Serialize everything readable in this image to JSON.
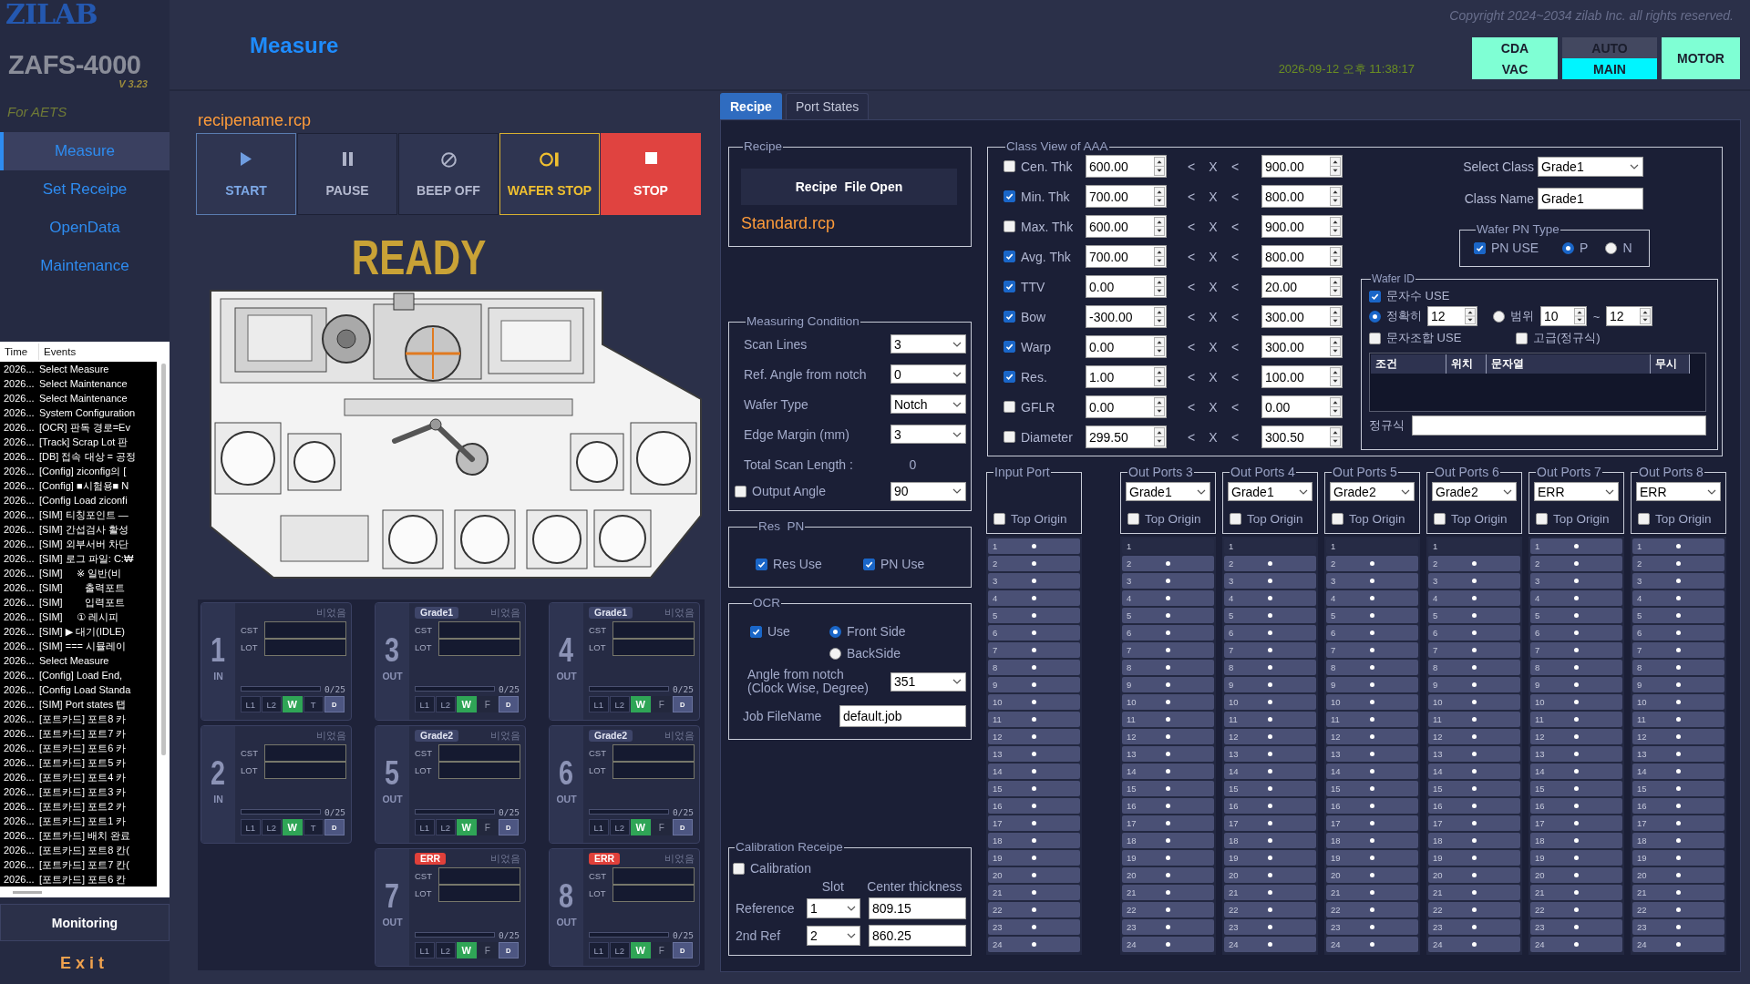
{
  "sidebar": {
    "logo": "ZILAB",
    "product": "ZAFS-4000",
    "version": "V 3.23",
    "customer": "For AETS",
    "nav": [
      {
        "label": "Measure",
        "selected": true
      },
      {
        "label": "Set Receipe",
        "selected": false
      },
      {
        "label": "OpenData",
        "selected": false
      },
      {
        "label": "Maintenance",
        "selected": false
      }
    ],
    "events": {
      "columns": [
        "Time",
        "Events"
      ],
      "rows": [
        {
          "time": "2026...",
          "event": "Select Measure"
        },
        {
          "time": "2026...",
          "event": "Select Maintenance"
        },
        {
          "time": "2026...",
          "event": "Select Maintenance"
        },
        {
          "time": "2026...",
          "event": "System Configuration"
        },
        {
          "time": "2026...",
          "event": "[OCR] 판독 경로=Ev"
        },
        {
          "time": "2026...",
          "event": "[Track] Scrap Lot 판"
        },
        {
          "time": "2026...",
          "event": "[DB] 접속 대상 = 공정"
        },
        {
          "time": "2026...",
          "event": "[Config] ziconfig의 ["
        },
        {
          "time": "2026...",
          "event": "[Config] ■시험용■ N"
        },
        {
          "time": "2026...",
          "event": "[Config Load ziconfi"
        },
        {
          "time": "2026...",
          "event": "[SIM] 티칭포인트 —"
        },
        {
          "time": "2026...",
          "event": "[SIM] 간섭검사 활성"
        },
        {
          "time": "2026...",
          "event": "[SIM] 외부서버 차단"
        },
        {
          "time": "2026...",
          "event": "[SIM] 로그 파일: C:₩"
        },
        {
          "time": "2026...",
          "event": "[SIM]     ※ 일반(비"
        },
        {
          "time": "2026...",
          "event": "[SIM]        출력포트"
        },
        {
          "time": "2026...",
          "event": "[SIM]        입력포트"
        },
        {
          "time": "2026...",
          "event": "[SIM]     ① 레시피"
        },
        {
          "time": "2026...",
          "event": "[SIM] ▶ 대기(IDLE)"
        },
        {
          "time": "2026...",
          "event": "[SIM] === 시뮬레이"
        },
        {
          "time": "2026...",
          "event": "Select Measure"
        },
        {
          "time": "2026...",
          "event": "[Config] Load End,"
        },
        {
          "time": "2026...",
          "event": "[Config Load Standa"
        },
        {
          "time": "2026...",
          "event": "[SIM] Port states 탭"
        },
        {
          "time": "2026...",
          "event": "[포트카드] 포트8 카"
        },
        {
          "time": "2026...",
          "event": "[포트카드] 포트7 카"
        },
        {
          "time": "2026...",
          "event": "[포트카드] 포트6 카"
        },
        {
          "time": "2026...",
          "event": "[포트카드] 포트5 카"
        },
        {
          "time": "2026...",
          "event": "[포트카드] 포트4 카"
        },
        {
          "time": "2026...",
          "event": "[포트카드] 포트3 카"
        },
        {
          "time": "2026...",
          "event": "[포트카드] 포트2 카"
        },
        {
          "time": "2026...",
          "event": "[포트카드] 포트1 카"
        },
        {
          "time": "2026...",
          "event": "[포트카드] 배치 완료"
        },
        {
          "time": "2026...",
          "event": "[포트카드] 포트8 칸("
        },
        {
          "time": "2026...",
          "event": "[포트카드] 포트7 칸("
        },
        {
          "time": "2026...",
          "event": "[포트카드] 포트6 칸"
        }
      ]
    },
    "monitoring_button": "Monitoring",
    "exit_button": "Exit"
  },
  "header": {
    "title": "Measure",
    "copyright": "Copyright 2024~2034 zilab Inc. all rights reserved.",
    "datetime": "2026-09-12 오후 11:38:17",
    "indicators": [
      {
        "cells": [
          {
            "label": "CDA",
            "on": true,
            "color": "#7fffd4"
          },
          {
            "label": "VAC",
            "on": true,
            "color": "#7fffd4"
          }
        ]
      },
      {
        "cells": [
          {
            "label": "AUTO",
            "on": false
          },
          {
            "label": "MAIN",
            "on": true,
            "color": "#00f5ff"
          }
        ]
      },
      {
        "cells": [
          {
            "label": "MOTOR",
            "on": true,
            "color": "#7fffd4"
          }
        ]
      }
    ]
  },
  "controls": {
    "recipe_name": "recipename.rcp",
    "buttons": [
      {
        "kind": "start",
        "label": "START"
      },
      {
        "kind": "pause",
        "label": "PAUSE"
      },
      {
        "kind": "beep",
        "label": "BEEP OFF"
      },
      {
        "kind": "wafer_stop",
        "label": "WAFER STOP"
      },
      {
        "kind": "stop",
        "label": "STOP"
      }
    ],
    "status": "READY"
  },
  "ports": [
    {
      "kind": "in",
      "number": "1",
      "direction": "IN",
      "status": "비었음",
      "cst_label": "CST",
      "lot_label": "LOT",
      "level": 0,
      "count": "0/25",
      "buttons": [
        {
          "kind": "lamp",
          "label": "L1",
          "on": false,
          "disabled": false
        },
        {
          "kind": "lamp",
          "label": "L2",
          "on": false,
          "disabled": false
        },
        {
          "kind": "lamp",
          "label": "W",
          "on": true,
          "disabled": false
        },
        {
          "kind": "lamp",
          "label": "T",
          "on": false,
          "disabled": false
        },
        {
          "kind": "action",
          "label": "D",
          "on": false,
          "disabled": false
        }
      ]
    },
    {
      "kind": "out",
      "number": "3",
      "direction": "OUT",
      "badge": {
        "kind": "grade",
        "text": "Grade1"
      },
      "status": "비었음",
      "cst_label": "CST",
      "lot_label": "LOT",
      "level": 0,
      "count": "0/25",
      "buttons": [
        {
          "kind": "lamp",
          "label": "L1",
          "on": false,
          "disabled": false
        },
        {
          "kind": "lamp",
          "label": "L2",
          "on": false,
          "disabled": false
        },
        {
          "kind": "lamp",
          "label": "W",
          "on": true,
          "disabled": false
        },
        {
          "kind": "lamp",
          "label": "F",
          "on": false,
          "disabled": true
        },
        {
          "kind": "action",
          "label": "D",
          "on": false,
          "disabled": false
        }
      ]
    },
    {
      "kind": "out",
      "number": "4",
      "direction": "OUT",
      "badge": {
        "kind": "grade",
        "text": "Grade1"
      },
      "status": "비었음",
      "cst_label": "CST",
      "lot_label": "LOT",
      "level": 0,
      "count": "0/25",
      "buttons": [
        {
          "kind": "lamp",
          "label": "L1",
          "on": false,
          "disabled": false
        },
        {
          "kind": "lamp",
          "label": "L2",
          "on": false,
          "disabled": false
        },
        {
          "kind": "lamp",
          "label": "W",
          "on": true,
          "disabled": false
        },
        {
          "kind": "lamp",
          "label": "F",
          "on": false,
          "disabled": true
        },
        {
          "kind": "action",
          "label": "D",
          "on": false,
          "disabled": false
        }
      ]
    },
    {
      "kind": "in",
      "number": "2",
      "direction": "IN",
      "status": "비었음",
      "cst_label": "CST",
      "lot_label": "LOT",
      "level": 0,
      "count": "0/25",
      "buttons": [
        {
          "kind": "lamp",
          "label": "L1",
          "on": false,
          "disabled": false
        },
        {
          "kind": "lamp",
          "label": "L2",
          "on": false,
          "disabled": false
        },
        {
          "kind": "lamp",
          "label": "W",
          "on": true,
          "disabled": false
        },
        {
          "kind": "lamp",
          "label": "T",
          "on": false,
          "disabled": false
        },
        {
          "kind": "action",
          "label": "D",
          "on": false,
          "disabled": false
        }
      ]
    },
    {
      "kind": "out",
      "number": "5",
      "direction": "OUT",
      "badge": {
        "kind": "grade",
        "text": "Grade2"
      },
      "status": "비었음",
      "cst_label": "CST",
      "lot_label": "LOT",
      "level": 0,
      "count": "0/25",
      "buttons": [
        {
          "kind": "lamp",
          "label": "L1",
          "on": false,
          "disabled": false
        },
        {
          "kind": "lamp",
          "label": "L2",
          "on": false,
          "disabled": false
        },
        {
          "kind": "lamp",
          "label": "W",
          "on": true,
          "disabled": false
        },
        {
          "kind": "lamp",
          "label": "F",
          "on": false,
          "disabled": true
        },
        {
          "kind": "action",
          "label": "D",
          "on": false,
          "disabled": false
        }
      ]
    },
    {
      "kind": "out",
      "number": "6",
      "direction": "OUT",
      "badge": {
        "kind": "grade",
        "text": "Grade2"
      },
      "status": "비었음",
      "cst_label": "CST",
      "lot_label": "LOT",
      "level": 0,
      "count": "0/25",
      "buttons": [
        {
          "kind": "lamp",
          "label": "L1",
          "on": false,
          "disabled": false
        },
        {
          "kind": "lamp",
          "label": "L2",
          "on": false,
          "disabled": false
        },
        {
          "kind": "lamp",
          "label": "W",
          "on": true,
          "disabled": false
        },
        {
          "kind": "lamp",
          "label": "F",
          "on": false,
          "disabled": true
        },
        {
          "kind": "action",
          "label": "D",
          "on": false,
          "disabled": false
        }
      ]
    },
    {
      "kind": "out",
      "number": "7",
      "direction": "OUT",
      "badge": {
        "kind": "error",
        "text": "ERR"
      },
      "status": "비었음",
      "cst_label": "CST",
      "lot_label": "LOT",
      "level": 0,
      "count": "0/25",
      "buttons": [
        {
          "kind": "lamp",
          "label": "L1",
          "on": false,
          "disabled": false
        },
        {
          "kind": "lamp",
          "label": "L2",
          "on": false,
          "disabled": false
        },
        {
          "kind": "lamp",
          "label": "W",
          "on": true,
          "disabled": false
        },
        {
          "kind": "lamp",
          "label": "F",
          "on": false,
          "disabled": true
        },
        {
          "kind": "action",
          "label": "D",
          "on": false,
          "disabled": false
        }
      ]
    },
    {
      "kind": "out",
      "number": "8",
      "direction": "OUT",
      "badge": {
        "kind": "error",
        "text": "ERR"
      },
      "status": "비었음",
      "cst_label": "CST",
      "lot_label": "LOT",
      "level": 0,
      "count": "0/25",
      "buttons": [
        {
          "kind": "lamp",
          "label": "L1",
          "on": false,
          "disabled": false
        },
        {
          "kind": "lamp",
          "label": "L2",
          "on": false,
          "disabled": false
        },
        {
          "kind": "lamp",
          "label": "W",
          "on": true,
          "disabled": false
        },
        {
          "kind": "lamp",
          "label": "F",
          "on": false,
          "disabled": true
        },
        {
          "kind": "action",
          "label": "D",
          "on": false,
          "disabled": false
        }
      ]
    }
  ],
  "panel": {
    "tabs": [
      {
        "label": "Recipe",
        "selected": true
      },
      {
        "label": "Port States",
        "selected": false
      }
    ],
    "recipe": {
      "title": "Recipe",
      "open_button": "Recipe  File Open",
      "file": "Standard.rcp"
    },
    "measuring": {
      "title": "Measuring Condition",
      "rows": [
        {
          "kind": "select",
          "label": "Scan Lines",
          "value": "3"
        },
        {
          "kind": "select",
          "label": "Ref. Angle from notch",
          "value": "0"
        },
        {
          "kind": "select",
          "label": "Wafer Type",
          "value": "Notch"
        },
        {
          "kind": "select",
          "label": "Edge Margin (mm)",
          "value": "3"
        },
        {
          "kind": "readout",
          "label": "Total Scan Length :",
          "value": "0"
        },
        {
          "kind": "check_select",
          "label": "Output Angle",
          "checked": false,
          "value": "90"
        }
      ]
    },
    "res_pn": {
      "title": "Res  PN",
      "items": [
        {
          "label": "Res Use",
          "checked": true
        },
        {
          "label": "PN Use",
          "checked": true
        }
      ]
    },
    "ocr": {
      "title": "OCR",
      "use": {
        "label": "Use",
        "checked": true
      },
      "sides": [
        {
          "label": "Front Side",
          "selected": true
        },
        {
          "label": "BackSide",
          "selected": false
        }
      ],
      "angle_label": [
        "Angle from notch",
        "(Clock Wise, Degree)"
      ],
      "angle": "351",
      "job_label": "Job FileName",
      "job_file": "default.job"
    },
    "calibration": {
      "title": "Calibration Receipe",
      "enable": {
        "label": "Calibration",
        "checked": false
      },
      "slot_header": "Slot",
      "thickness_header": "Center thickness",
      "rows": [
        {
          "label": "Reference",
          "slot": "1",
          "thickness": "809.15"
        },
        {
          "label": "2nd Ref",
          "slot": "2",
          "thickness": "860.25"
        }
      ]
    },
    "class_view": {
      "title": "Class View of AAA",
      "rows": [
        {
          "label": "Cen. Thk",
          "checked": false,
          "min": "600.00",
          "op1": "<",
          "var": "X",
          "op2": "<",
          "max": "900.00"
        },
        {
          "label": "Min. Thk",
          "checked": true,
          "min": "700.00",
          "op1": "<",
          "var": "X",
          "op2": "<",
          "max": "800.00"
        },
        {
          "label": "Max. Thk",
          "checked": false,
          "min": "600.00",
          "op1": "<",
          "var": "X",
          "op2": "<",
          "max": "900.00"
        },
        {
          "label": "Avg. Thk",
          "checked": true,
          "min": "700.00",
          "op1": "<",
          "var": "X",
          "op2": "<",
          "max": "800.00"
        },
        {
          "label": "TTV",
          "checked": true,
          "min": "0.00",
          "op1": "<",
          "var": "X",
          "op2": "<",
          "max": "20.00"
        },
        {
          "label": "Bow",
          "checked": true,
          "min": "-300.00",
          "op1": "<",
          "var": "X",
          "op2": "<",
          "max": "300.00"
        },
        {
          "label": "Warp",
          "checked": true,
          "min": "0.00",
          "op1": "<",
          "var": "X",
          "op2": "<",
          "max": "300.00"
        },
        {
          "label": "Res.",
          "checked": true,
          "min": "1.00",
          "op1": "<",
          "var": "X",
          "op2": "<",
          "max": "100.00"
        },
        {
          "label": "GFLR",
          "checked": false,
          "min": "0.00",
          "op1": "<",
          "var": "X",
          "op2": "<",
          "max": "0.00"
        },
        {
          "label": "Diameter",
          "checked": false,
          "min": "299.50",
          "op1": "<",
          "var": "X",
          "op2": "<",
          "max": "300.50"
        }
      ],
      "select_class_label": "Select Class",
      "select_class": "Grade1",
      "class_name_label": "Class Name",
      "class_name": "Grade1",
      "pn_type": {
        "title": "Wafer PN Type",
        "use": {
          "label": "PN USE",
          "checked": true
        },
        "types": [
          {
            "label": "P",
            "selected": true
          },
          {
            "label": "N",
            "selected": false
          }
        ]
      },
      "wafer_id": {
        "title": "Wafer ID",
        "count_use": {
          "label": "문자수 USE",
          "checked": true
        },
        "exact": {
          "label": "정확히",
          "selected": true,
          "value": "12"
        },
        "range": {
          "label": "범위",
          "selected": false,
          "from": "10",
          "separator": "~",
          "to": "12"
        },
        "combo_use": {
          "label": "문자조합 USE",
          "checked": false
        },
        "regex_use": {
          "label": "고급(정규식)",
          "checked": false
        },
        "table_columns": [
          "조건",
          "위치",
          "문자열",
          "무시"
        ],
        "regex_label": "정규식"
      }
    },
    "port_groups": [
      {
        "title": "Input Port",
        "top_origin": {
          "label": "Top Origin",
          "checked": false
        },
        "slots": [
          {
            "number": "1",
            "disabled": false
          },
          {
            "number": "2",
            "disabled": false
          },
          {
            "number": "3",
            "disabled": false
          },
          {
            "number": "4",
            "disabled": false
          },
          {
            "number": "5",
            "disabled": false
          },
          {
            "number": "6",
            "disabled": false
          },
          {
            "number": "7",
            "disabled": false
          },
          {
            "number": "8",
            "disabled": false
          },
          {
            "number": "9",
            "disabled": false
          },
          {
            "number": "10",
            "disabled": false
          },
          {
            "number": "11",
            "disabled": false
          },
          {
            "number": "12",
            "disabled": false
          },
          {
            "number": "13",
            "disabled": false
          },
          {
            "number": "14",
            "disabled": false
          },
          {
            "number": "15",
            "disabled": false
          },
          {
            "number": "16",
            "disabled": false
          },
          {
            "number": "17",
            "disabled": false
          },
          {
            "number": "18",
            "disabled": false
          },
          {
            "number": "19",
            "disabled": false
          },
          {
            "number": "20",
            "disabled": false
          },
          {
            "number": "21",
            "disabled": false
          },
          {
            "number": "22",
            "disabled": false
          },
          {
            "number": "23",
            "disabled": false
          },
          {
            "number": "24",
            "disabled": false
          }
        ]
      },
      {
        "title": "Out Ports 3",
        "grade": "Grade1",
        "top_origin": {
          "label": "Top Origin",
          "checked": false
        },
        "slots": [
          {
            "number": "1",
            "disabled": true
          },
          {
            "number": "2",
            "disabled": false
          },
          {
            "number": "3",
            "disabled": false
          },
          {
            "number": "4",
            "disabled": false
          },
          {
            "number": "5",
            "disabled": false
          },
          {
            "number": "6",
            "disabled": false
          },
          {
            "number": "7",
            "disabled": false
          },
          {
            "number": "8",
            "disabled": false
          },
          {
            "number": "9",
            "disabled": false
          },
          {
            "number": "10",
            "disabled": false
          },
          {
            "number": "11",
            "disabled": false
          },
          {
            "number": "12",
            "disabled": false
          },
          {
            "number": "13",
            "disabled": false
          },
          {
            "number": "14",
            "disabled": false
          },
          {
            "number": "15",
            "disabled": false
          },
          {
            "number": "16",
            "disabled": false
          },
          {
            "number": "17",
            "disabled": false
          },
          {
            "number": "18",
            "disabled": false
          },
          {
            "number": "19",
            "disabled": false
          },
          {
            "number": "20",
            "disabled": false
          },
          {
            "number": "21",
            "disabled": false
          },
          {
            "number": "22",
            "disabled": false
          },
          {
            "number": "23",
            "disabled": false
          },
          {
            "number": "24",
            "disabled": false
          }
        ]
      },
      {
        "title": "Out Ports 4",
        "grade": "Grade1",
        "top_origin": {
          "label": "Top Origin",
          "checked": false
        },
        "slots": [
          {
            "number": "1",
            "disabled": true
          },
          {
            "number": "2",
            "disabled": false
          },
          {
            "number": "3",
            "disabled": false
          },
          {
            "number": "4",
            "disabled": false
          },
          {
            "number": "5",
            "disabled": false
          },
          {
            "number": "6",
            "disabled": false
          },
          {
            "number": "7",
            "disabled": false
          },
          {
            "number": "8",
            "disabled": false
          },
          {
            "number": "9",
            "disabled": false
          },
          {
            "number": "10",
            "disabled": false
          },
          {
            "number": "11",
            "disabled": false
          },
          {
            "number": "12",
            "disabled": false
          },
          {
            "number": "13",
            "disabled": false
          },
          {
            "number": "14",
            "disabled": false
          },
          {
            "number": "15",
            "disabled": false
          },
          {
            "number": "16",
            "disabled": false
          },
          {
            "number": "17",
            "disabled": false
          },
          {
            "number": "18",
            "disabled": false
          },
          {
            "number": "19",
            "disabled": false
          },
          {
            "number": "20",
            "disabled": false
          },
          {
            "number": "21",
            "disabled": false
          },
          {
            "number": "22",
            "disabled": false
          },
          {
            "number": "23",
            "disabled": false
          },
          {
            "number": "24",
            "disabled": false
          }
        ]
      },
      {
        "title": "Out Ports 5",
        "grade": "Grade2",
        "top_origin": {
          "label": "Top Origin",
          "checked": false
        },
        "slots": [
          {
            "number": "1",
            "disabled": true
          },
          {
            "number": "2",
            "disabled": false
          },
          {
            "number": "3",
            "disabled": false
          },
          {
            "number": "4",
            "disabled": false
          },
          {
            "number": "5",
            "disabled": false
          },
          {
            "number": "6",
            "disabled": false
          },
          {
            "number": "7",
            "disabled": false
          },
          {
            "number": "8",
            "disabled": false
          },
          {
            "number": "9",
            "disabled": false
          },
          {
            "number": "10",
            "disabled": false
          },
          {
            "number": "11",
            "disabled": false
          },
          {
            "number": "12",
            "disabled": false
          },
          {
            "number": "13",
            "disabled": false
          },
          {
            "number": "14",
            "disabled": false
          },
          {
            "number": "15",
            "disabled": false
          },
          {
            "number": "16",
            "disabled": false
          },
          {
            "number": "17",
            "disabled": false
          },
          {
            "number": "18",
            "disabled": false
          },
          {
            "number": "19",
            "disabled": false
          },
          {
            "number": "20",
            "disabled": false
          },
          {
            "number": "21",
            "disabled": false
          },
          {
            "number": "22",
            "disabled": false
          },
          {
            "number": "23",
            "disabled": false
          },
          {
            "number": "24",
            "disabled": false
          }
        ]
      },
      {
        "title": "Out Ports 6",
        "grade": "Grade2",
        "top_origin": {
          "label": "Top Origin",
          "checked": false
        },
        "slots": [
          {
            "number": "1",
            "disabled": true
          },
          {
            "number": "2",
            "disabled": false
          },
          {
            "number": "3",
            "disabled": false
          },
          {
            "number": "4",
            "disabled": false
          },
          {
            "number": "5",
            "disabled": false
          },
          {
            "number": "6",
            "disabled": false
          },
          {
            "number": "7",
            "disabled": false
          },
          {
            "number": "8",
            "disabled": false
          },
          {
            "number": "9",
            "disabled": false
          },
          {
            "number": "10",
            "disabled": false
          },
          {
            "number": "11",
            "disabled": false
          },
          {
            "number": "12",
            "disabled": false
          },
          {
            "number": "13",
            "disabled": false
          },
          {
            "number": "14",
            "disabled": false
          },
          {
            "number": "15",
            "disabled": false
          },
          {
            "number": "16",
            "disabled": false
          },
          {
            "number": "17",
            "disabled": false
          },
          {
            "number": "18",
            "disabled": false
          },
          {
            "number": "19",
            "disabled": false
          },
          {
            "number": "20",
            "disabled": false
          },
          {
            "number": "21",
            "disabled": false
          },
          {
            "number": "22",
            "disabled": false
          },
          {
            "number": "23",
            "disabled": false
          },
          {
            "number": "24",
            "disabled": false
          }
        ]
      },
      {
        "title": "Out Ports 7",
        "grade": "ERR",
        "top_origin": {
          "label": "Top Origin",
          "checked": false
        },
        "slots": [
          {
            "number": "1",
            "disabled": false
          },
          {
            "number": "2",
            "disabled": false
          },
          {
            "number": "3",
            "disabled": false
          },
          {
            "number": "4",
            "disabled": false
          },
          {
            "number": "5",
            "disabled": false
          },
          {
            "number": "6",
            "disabled": false
          },
          {
            "number": "7",
            "disabled": false
          },
          {
            "number": "8",
            "disabled": false
          },
          {
            "number": "9",
            "disabled": false
          },
          {
            "number": "10",
            "disabled": false
          },
          {
            "number": "11",
            "disabled": false
          },
          {
            "number": "12",
            "disabled": false
          },
          {
            "number": "13",
            "disabled": false
          },
          {
            "number": "14",
            "disabled": false
          },
          {
            "number": "15",
            "disabled": false
          },
          {
            "number": "16",
            "disabled": false
          },
          {
            "number": "17",
            "disabled": false
          },
          {
            "number": "18",
            "disabled": false
          },
          {
            "number": "19",
            "disabled": false
          },
          {
            "number": "20",
            "disabled": false
          },
          {
            "number": "21",
            "disabled": false
          },
          {
            "number": "22",
            "disabled": false
          },
          {
            "number": "23",
            "disabled": false
          },
          {
            "number": "24",
            "disabled": false
          }
        ]
      },
      {
        "title": "Out Ports 8",
        "grade": "ERR",
        "top_origin": {
          "label": "Top Origin",
          "checked": false
        },
        "slots": [
          {
            "number": "1",
            "disabled": false
          },
          {
            "number": "2",
            "disabled": false
          },
          {
            "number": "3",
            "disabled": false
          },
          {
            "number": "4",
            "disabled": false
          },
          {
            "number": "5",
            "disabled": false
          },
          {
            "number": "6",
            "disabled": false
          },
          {
            "number": "7",
            "disabled": false
          },
          {
            "number": "8",
            "disabled": false
          },
          {
            "number": "9",
            "disabled": false
          },
          {
            "number": "10",
            "disabled": false
          },
          {
            "number": "11",
            "disabled": false
          },
          {
            "number": "12",
            "disabled": false
          },
          {
            "number": "13",
            "disabled": false
          },
          {
            "number": "14",
            "disabled": false
          },
          {
            "number": "15",
            "disabled": false
          },
          {
            "number": "16",
            "disabled": false
          },
          {
            "number": "17",
            "disabled": false
          },
          {
            "number": "18",
            "disabled": false
          },
          {
            "number": "19",
            "disabled": false
          },
          {
            "number": "20",
            "disabled": false
          },
          {
            "number": "21",
            "disabled": false
          },
          {
            "number": "22",
            "disabled": false
          },
          {
            "number": "23",
            "disabled": false
          },
          {
            "number": "24",
            "disabled": false
          }
        ]
      }
    ]
  }
}
